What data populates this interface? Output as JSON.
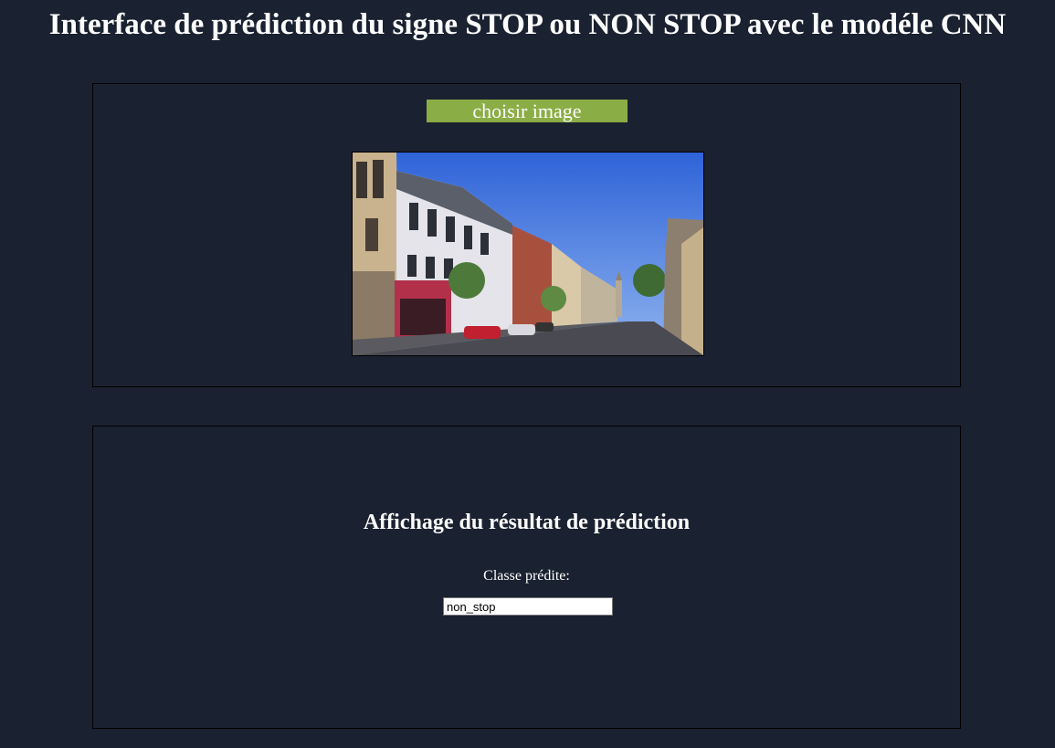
{
  "page": {
    "title": "Interface de prédiction du signe STOP ou NON STOP avec le modéle CNN"
  },
  "upload": {
    "choose_label": "choisir image"
  },
  "result": {
    "heading": "Affichage du résultat de prédiction",
    "class_label": "Classe prédite:",
    "predicted_class": "non_stop"
  },
  "colors": {
    "background": "#1a2130",
    "button": "#8bad45"
  }
}
